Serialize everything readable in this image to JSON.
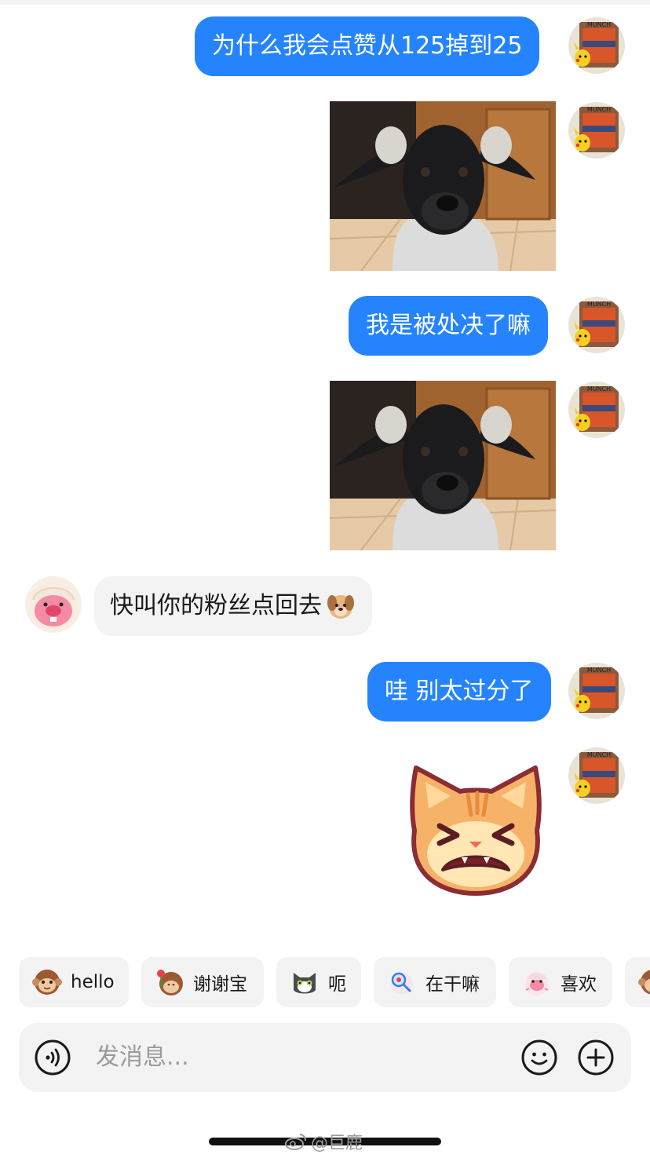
{
  "messages": {
    "m1": "为什么我会点赞从125掉到25",
    "m3": "我是被处决了嘛",
    "m5": "快叫你的粉丝点回去",
    "m6": "哇 别太过分了"
  },
  "quick_replies": [
    {
      "label": "hello",
      "icon": "monkey-icon"
    },
    {
      "label": "谢谢宝",
      "icon": "monkey-flower-icon"
    },
    {
      "label": "呃",
      "icon": "cat-icon"
    },
    {
      "label": "在干嘛",
      "icon": "magnifier-character-icon"
    },
    {
      "label": "喜欢",
      "icon": "pink-character-icon"
    }
  ],
  "input": {
    "placeholder": "发消息..."
  },
  "watermark": {
    "text": "@巨鹿"
  },
  "colors": {
    "outgoing_bubble": "#2584fd",
    "incoming_bubble": "#f3f3f3",
    "background": "#ffffff"
  }
}
